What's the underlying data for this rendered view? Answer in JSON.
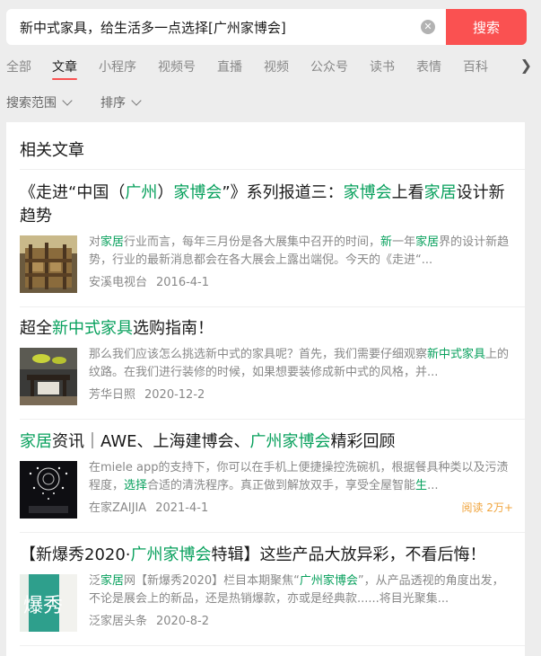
{
  "search": {
    "query": "新中式家具，给生活多一点选择[广州家博会]",
    "button_label": "搜索"
  },
  "tabs": [
    {
      "label": "全部"
    },
    {
      "label": "文章"
    },
    {
      "label": "小程序"
    },
    {
      "label": "视频号"
    },
    {
      "label": "直播"
    },
    {
      "label": "视频"
    },
    {
      "label": "公众号"
    },
    {
      "label": "读书"
    },
    {
      "label": "表情"
    },
    {
      "label": "百科"
    }
  ],
  "filters": [
    {
      "label": "搜索范围"
    },
    {
      "label": "排序"
    }
  ],
  "section_title": "相关文章",
  "colors": {
    "accent": "#fa5151",
    "highlight": "#07a05c",
    "reads": "#f0a43c"
  },
  "articles": [
    {
      "title": [
        {
          "t": "《走进“中国（"
        },
        {
          "t": "广州",
          "h": true
        },
        {
          "t": "）"
        },
        {
          "t": "家博会",
          "h": true
        },
        {
          "t": "”》系列报道三："
        },
        {
          "t": "家博会",
          "h": true
        },
        {
          "t": "上看"
        },
        {
          "t": "家居",
          "h": true
        },
        {
          "t": "设计新趋势"
        }
      ],
      "snippet": [
        {
          "t": "对"
        },
        {
          "t": "家居",
          "h": true
        },
        {
          "t": "行业而言，每年三月份是各大展集中召开的时间，"
        },
        {
          "t": "新",
          "h": true
        },
        {
          "t": "一年"
        },
        {
          "t": "家居",
          "h": true
        },
        {
          "t": "界的设计新趋势，行业的最新消息都会在各大展会上露出端倪。今天的《走进“..."
        }
      ],
      "source": "安溪电视台",
      "date": "2016-4-1",
      "reads": ""
    },
    {
      "title": [
        {
          "t": "超全"
        },
        {
          "t": "新中式家具",
          "h": true
        },
        {
          "t": "选购指南！"
        }
      ],
      "snippet": [
        {
          "t": "那么我们应该怎么挑选新中式的家具呢？首先，我们需要仔细观察"
        },
        {
          "t": "新中式家具",
          "h": true
        },
        {
          "t": "上的纹路。在我们进行装修的时候，如果想要装修成新中式的风格，并..."
        }
      ],
      "source": "芳华日照",
      "date": "2020-12-2",
      "reads": ""
    },
    {
      "title": [
        {
          "t": "家居",
          "h": true
        },
        {
          "t": "资讯｜AWE、上海建博会、"
        },
        {
          "t": "广州家博会",
          "h": true
        },
        {
          "t": "精彩回顾"
        }
      ],
      "snippet": [
        {
          "t": "在miele app的支持下，你可以在手机上便捷操控洗碗机，根据餐具种类以及污渍程度，"
        },
        {
          "t": "选择",
          "h": true
        },
        {
          "t": "合适的清洗程序。真正做到解放双手，享受全屋智能"
        },
        {
          "t": "生",
          "h": true
        },
        {
          "t": "..."
        }
      ],
      "source": "在家ZAIJIA",
      "date": "2021-4-1",
      "reads": "阅读 2万+"
    },
    {
      "title": [
        {
          "t": "【新爆秀2020·"
        },
        {
          "t": "广州家博会",
          "h": true
        },
        {
          "t": "特辑】这些产品大放异彩，不看后悔！"
        }
      ],
      "snippet": [
        {
          "t": "泛"
        },
        {
          "t": "家居",
          "h": true
        },
        {
          "t": "网【新爆秀2020】栏目本期聚焦“"
        },
        {
          "t": "广州家博会",
          "h": true
        },
        {
          "t": "”，从产品透视的角度出发，不论是展会上的新品，还是热销爆款，亦或是经典款......将目光聚集..."
        }
      ],
      "source": "泛家居头条",
      "date": "2020-8-2",
      "reads": ""
    }
  ],
  "thumb4_text": "爆秀"
}
